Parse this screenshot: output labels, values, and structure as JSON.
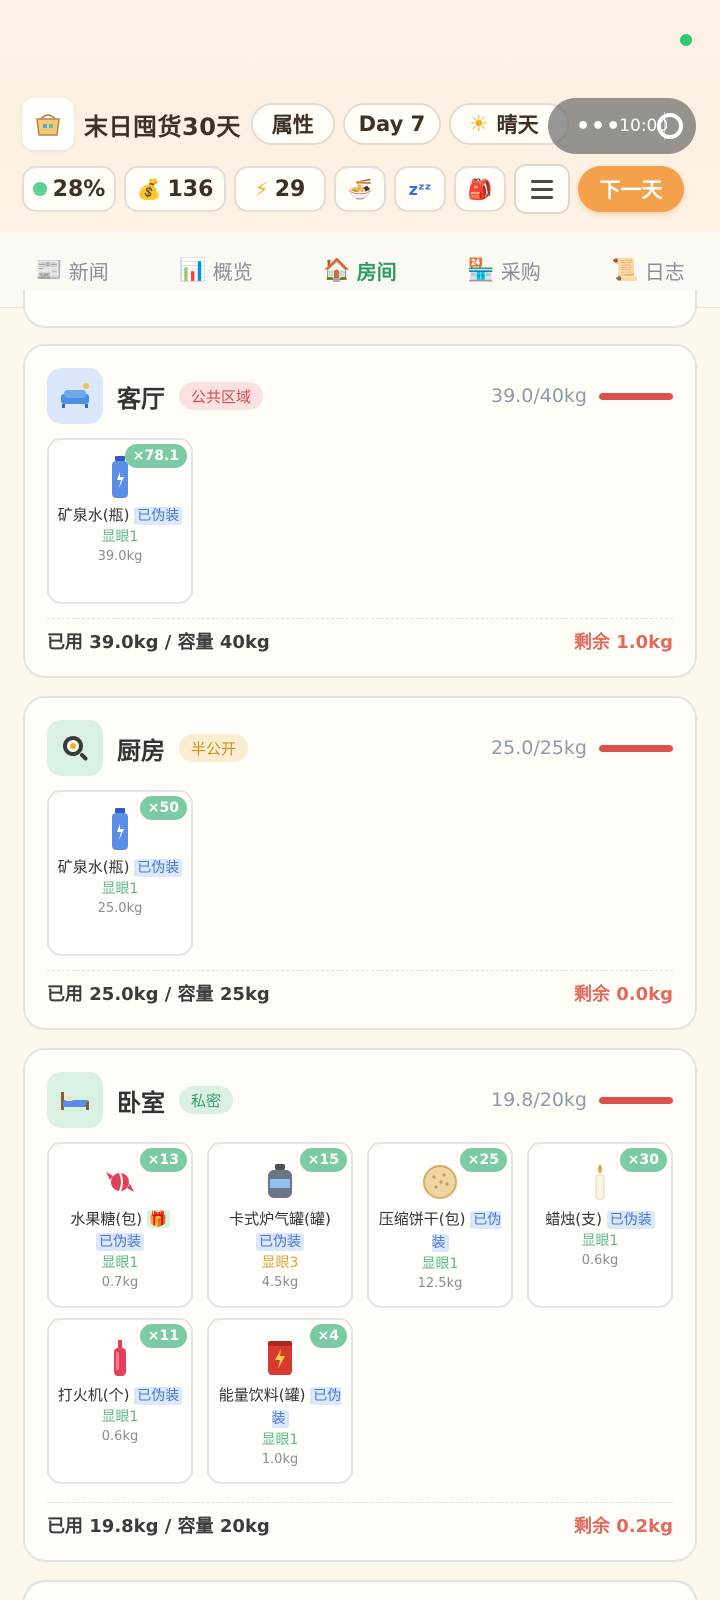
{
  "header": {
    "title": "末日囤货30天",
    "attr_label": "属性",
    "day_label": "Day 7",
    "weather_label": "晴天",
    "capsule_time": "10:00",
    "stats": {
      "health": "28%",
      "money": "136",
      "energy": "29"
    },
    "next_day_label": "下一天"
  },
  "tabs": [
    {
      "label": "新闻",
      "icon": "newspaper-icon"
    },
    {
      "label": "概览",
      "icon": "chart-icon"
    },
    {
      "label": "房间",
      "icon": "house-icon"
    },
    {
      "label": "采购",
      "icon": "store-icon"
    },
    {
      "label": "日志",
      "icon": "scroll-icon"
    }
  ],
  "active_tab": "房间",
  "rooms": [
    {
      "name": "客厅",
      "tag": "公共区域",
      "weight": "39.0/40kg",
      "used": "已用 39.0kg / 容量 40kg",
      "remaining": "剩余 1.0kg",
      "items": [
        {
          "name": "矿泉水(瓶)",
          "disguise": "已伪装",
          "count": "×78.1",
          "visibility": "显眼1",
          "weight": "39.0kg",
          "icon": "water-bottle-icon"
        }
      ]
    },
    {
      "name": "厨房",
      "tag": "半公开",
      "weight": "25.0/25kg",
      "used": "已用 25.0kg / 容量 25kg",
      "remaining": "剩余 0.0kg",
      "items": [
        {
          "name": "矿泉水(瓶)",
          "disguise": "已伪装",
          "count": "×50",
          "visibility": "显眼1",
          "weight": "25.0kg",
          "icon": "water-bottle-icon"
        }
      ]
    },
    {
      "name": "卧室",
      "tag": "私密",
      "weight": "19.8/20kg",
      "used": "已用 19.8kg / 容量 20kg",
      "remaining": "剩余 0.2kg",
      "items": [
        {
          "name": "水果糖(包)",
          "disguise": "已伪装",
          "count": "×13",
          "visibility": "显眼1",
          "weight": "0.7kg",
          "icon": "candy-icon"
        },
        {
          "name": "卡式炉气罐(罐)",
          "disguise": "已伪装",
          "count": "×15",
          "visibility": "显眼3",
          "weight": "4.5kg",
          "icon": "gas-can-icon"
        },
        {
          "name": "压缩饼干(包)",
          "disguise": "已伪装",
          "count": "×25",
          "visibility": "显眼1",
          "weight": "12.5kg",
          "icon": "biscuit-icon"
        },
        {
          "name": "蜡烛(支)",
          "disguise": "已伪装",
          "count": "×30",
          "visibility": "显眼1",
          "weight": "0.6kg",
          "icon": "candle-icon"
        },
        {
          "name": "打火机(个)",
          "disguise": "已伪装",
          "count": "×11",
          "visibility": "显眼1",
          "weight": "0.6kg",
          "icon": "lighter-icon"
        },
        {
          "name": "能量饮料(罐)",
          "disguise": "已伪装",
          "count": "×4",
          "visibility": "显眼1",
          "weight": "1.0kg",
          "icon": "energy-drink-icon"
        }
      ]
    }
  ],
  "colors": {
    "accent_green": "#2e9c66",
    "next_button": "#f4a14b",
    "remaining_red": "#e06a5c",
    "capacity_bar": "#d9534a"
  }
}
